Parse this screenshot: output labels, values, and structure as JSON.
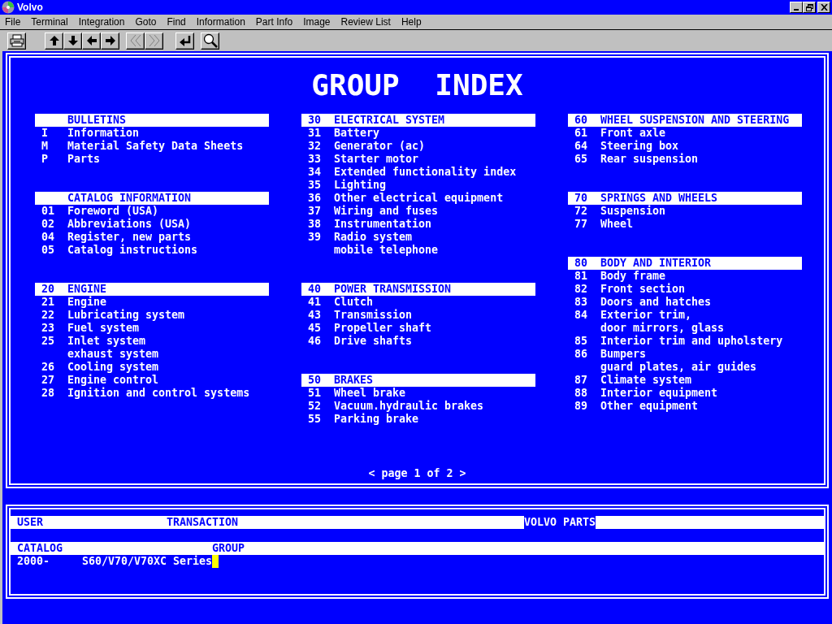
{
  "window": {
    "title": "Volvo"
  },
  "menu": [
    "File",
    "Terminal",
    "Integration",
    "Goto",
    "Find",
    "Information",
    "Part Info",
    "Image",
    "Review List",
    "Help"
  ],
  "index": {
    "title": "GROUP INDEX",
    "columns": [
      [
        {
          "name": "BULLETINS",
          "items": [
            {
              "code": "I",
              "lines": [
                "Information"
              ]
            },
            {
              "code": "M",
              "lines": [
                "Material Safety Data Sheets"
              ]
            },
            {
              "code": "P",
              "lines": [
                "Parts"
              ]
            }
          ]
        },
        {
          "name": "CATALOG INFORMATION",
          "items": [
            {
              "code": "01",
              "lines": [
                "Foreword (USA)"
              ]
            },
            {
              "code": "02",
              "lines": [
                "Abbreviations (USA)"
              ]
            },
            {
              "code": "04",
              "lines": [
                "Register, new parts"
              ]
            },
            {
              "code": "05",
              "lines": [
                "Catalog instructions"
              ]
            }
          ]
        },
        {
          "code": "20",
          "name": "ENGINE",
          "items": [
            {
              "code": "21",
              "lines": [
                "Engine"
              ]
            },
            {
              "code": "22",
              "lines": [
                "Lubricating system"
              ]
            },
            {
              "code": "23",
              "lines": [
                "Fuel system"
              ]
            },
            {
              "code": "25",
              "lines": [
                "Inlet system",
                "exhaust system"
              ]
            },
            {
              "code": "26",
              "lines": [
                "Cooling system"
              ]
            },
            {
              "code": "27",
              "lines": [
                "Engine control"
              ]
            },
            {
              "code": "28",
              "lines": [
                "Ignition and control systems"
              ]
            }
          ]
        }
      ],
      [
        {
          "code": "30",
          "name": "ELECTRICAL SYSTEM",
          "items": [
            {
              "code": "31",
              "lines": [
                "Battery"
              ]
            },
            {
              "code": "32",
              "lines": [
                "Generator (ac)"
              ]
            },
            {
              "code": "33",
              "lines": [
                "Starter motor"
              ]
            },
            {
              "code": "34",
              "lines": [
                "Extended functionality index"
              ]
            },
            {
              "code": "35",
              "lines": [
                "Lighting"
              ]
            },
            {
              "code": "36",
              "lines": [
                "Other electrical equipment"
              ]
            },
            {
              "code": "37",
              "lines": [
                "Wiring and fuses"
              ]
            },
            {
              "code": "38",
              "lines": [
                "Instrumentation"
              ]
            },
            {
              "code": "39",
              "lines": [
                "Radio system",
                "mobile telephone"
              ]
            }
          ]
        },
        {
          "code": "40",
          "name": "POWER TRANSMISSION",
          "items": [
            {
              "code": "41",
              "lines": [
                "Clutch"
              ]
            },
            {
              "code": "43",
              "lines": [
                "Transmission"
              ]
            },
            {
              "code": "45",
              "lines": [
                "Propeller shaft"
              ]
            },
            {
              "code": "46",
              "lines": [
                "Drive shafts"
              ]
            }
          ]
        },
        {
          "code": "50",
          "name": "BRAKES",
          "items": [
            {
              "code": "51",
              "lines": [
                "Wheel brake"
              ]
            },
            {
              "code": "52",
              "lines": [
                "Vacuum.hydraulic brakes"
              ]
            },
            {
              "code": "55",
              "lines": [
                "Parking brake"
              ]
            }
          ]
        }
      ],
      [
        {
          "code": "60",
          "name": "WHEEL SUSPENSION AND STEERING",
          "items": [
            {
              "code": "61",
              "lines": [
                "Front axle"
              ]
            },
            {
              "code": "64",
              "lines": [
                "Steering box"
              ]
            },
            {
              "code": "65",
              "lines": [
                "Rear suspension"
              ]
            }
          ]
        },
        {
          "code": "70",
          "name": "SPRINGS AND WHEELS",
          "items": [
            {
              "code": "72",
              "lines": [
                "Suspension"
              ]
            },
            {
              "code": "77",
              "lines": [
                "Wheel"
              ]
            }
          ]
        },
        {
          "code": "80",
          "name": "BODY AND INTERIOR",
          "items": [
            {
              "code": "81",
              "lines": [
                "Body frame"
              ]
            },
            {
              "code": "82",
              "lines": [
                "Front section"
              ]
            },
            {
              "code": "83",
              "lines": [
                "Doors and hatches"
              ]
            },
            {
              "code": "84",
              "lines": [
                "Exterior trim,",
                "door mirrors, glass"
              ]
            },
            {
              "code": "85",
              "lines": [
                "Interior trim and upholstery"
              ]
            },
            {
              "code": "86",
              "lines": [
                "Bumpers",
                "guard plates, air guides"
              ]
            },
            {
              "code": "87",
              "lines": [
                "Climate system"
              ]
            },
            {
              "code": "88",
              "lines": [
                "Interior equipment"
              ]
            },
            {
              "code": "89",
              "lines": [
                "Other equipment"
              ]
            }
          ]
        }
      ]
    ],
    "pager": {
      "prev": "<",
      "text": "page 1 of 2",
      "next": ">"
    }
  },
  "session": {
    "header_row": [
      {
        "text": "USER",
        "highlighted": false
      },
      {
        "text": "TRANSACTION",
        "highlighted": false
      },
      {
        "text": "VOLVO PARTS",
        "highlighted": true
      }
    ],
    "label_row": [
      {
        "text": "CATALOG",
        "highlighted": false
      },
      {
        "text": "GROUP",
        "highlighted": false
      }
    ],
    "value_row": [
      "2000-",
      "S60/V70/V70XC Series"
    ]
  }
}
